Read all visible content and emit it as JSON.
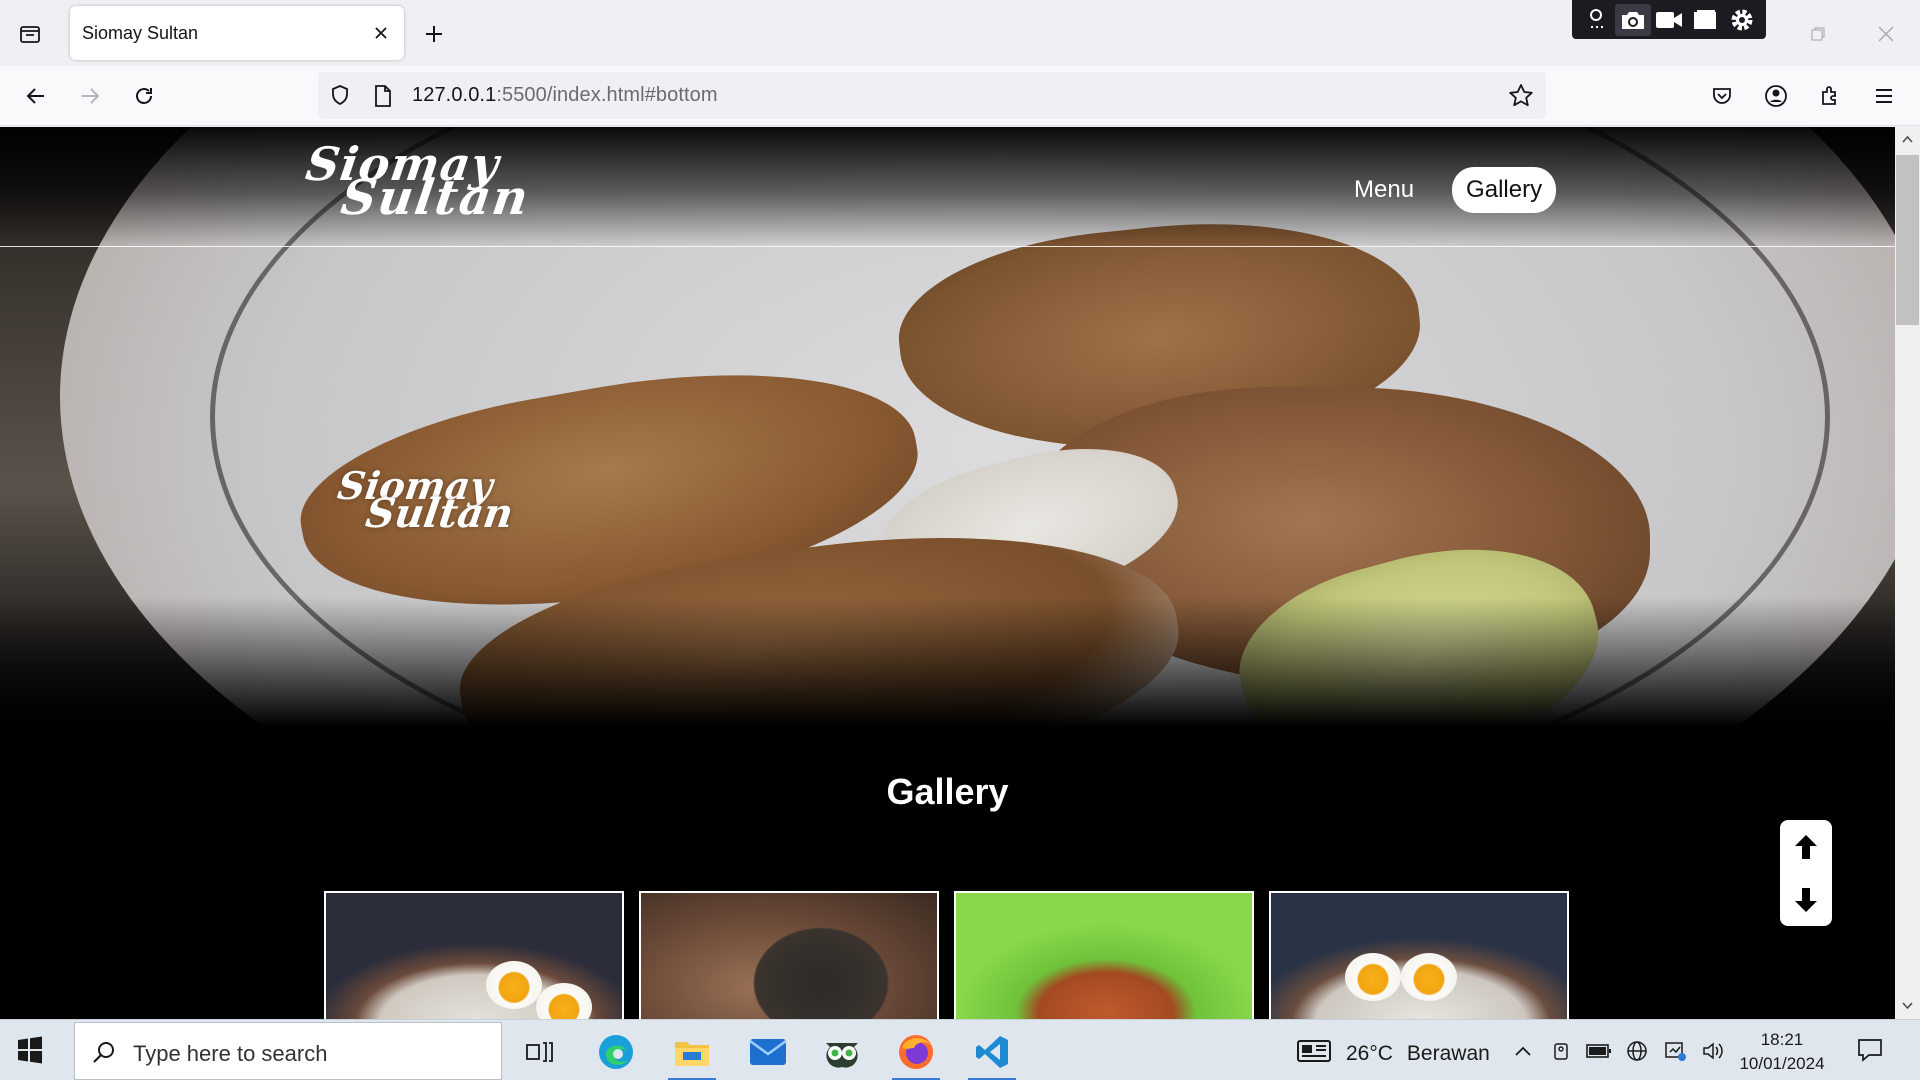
{
  "browser": {
    "tab_title": "Siomay Sultan",
    "url_host": "127.0.0.1",
    "url_rest": ":5500/index.html#bottom"
  },
  "site": {
    "logo_line1": "Siomay",
    "logo_line2": "Sultan",
    "nav": [
      {
        "label": "Menu",
        "active": false
      },
      {
        "label": "Gallery",
        "active": true
      }
    ],
    "hero_logo_line1": "Siomay",
    "hero_logo_line2": "Sultan",
    "gallery_title": "Gallery"
  },
  "taskbar": {
    "search_placeholder": "Type here to search",
    "temperature": "26°C",
    "weather_text": "Berawan",
    "time": "18:21",
    "date": "10/01/2024"
  },
  "colors": {
    "accent": "#3b7bd6",
    "site_background": "#000000",
    "nav_active_bg": "#ffffff"
  }
}
